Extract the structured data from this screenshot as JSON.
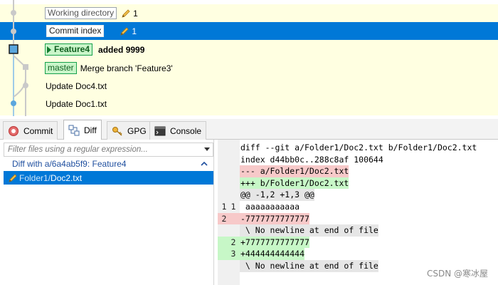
{
  "graph": {
    "rows": [
      {
        "label": "Working directory",
        "count": "1"
      },
      {
        "label": "Commit index",
        "count": "1"
      },
      {
        "branch": "Feature4",
        "message": "added 9999"
      },
      {
        "branch": "master",
        "message": "Merge branch 'Feature3'"
      },
      {
        "message": "Update Doc4.txt"
      },
      {
        "message": "Update Doc1.txt"
      }
    ]
  },
  "tabs": [
    {
      "label": "Commit",
      "icon": "commit-icon"
    },
    {
      "label": "Diff",
      "icon": "diff-icon"
    },
    {
      "label": "GPG",
      "icon": "key-icon"
    },
    {
      "label": "Console",
      "icon": "console-icon"
    }
  ],
  "filelist": {
    "filter_placeholder": "Filter files using a regular expression...",
    "group_header": "Diff with a/6a4ab5f9: Feature4",
    "file": {
      "dir": "Folder1/",
      "name": "Doc2.txt"
    }
  },
  "diff": {
    "lines": [
      {
        "left": "",
        "right": "",
        "text": "diff --git a/Folder1/Doc2.txt b/Folder1/Doc2.txt",
        "kind": "header"
      },
      {
        "left": "",
        "right": "",
        "text": "index d44bb0c..288c8af 100644",
        "kind": "header"
      },
      {
        "left": "",
        "right": "",
        "text": "--- a/Folder1/Doc2.txt",
        "kind": "removed-header"
      },
      {
        "left": "",
        "right": "",
        "text": "+++ b/Folder1/Doc2.txt",
        "kind": "added-header"
      },
      {
        "left": "",
        "right": "",
        "text": "@@ -1,2 +1,3 @@",
        "kind": "hunk"
      },
      {
        "left": "1",
        "right": "1",
        "text": " aaaaaaaaaaa",
        "kind": "context"
      },
      {
        "left": "2",
        "right": "",
        "text": "-7777777777777",
        "kind": "removed"
      },
      {
        "left": "",
        "right": "",
        "text": " \\ No newline at end of file",
        "kind": "note"
      },
      {
        "left": "",
        "right": "2",
        "text": "+7777777777777",
        "kind": "added"
      },
      {
        "left": "",
        "right": "3",
        "text": "+444444444444",
        "kind": "added"
      },
      {
        "left": "",
        "right": "",
        "text": " \\ No newline at end of file",
        "kind": "note"
      }
    ]
  },
  "watermark": "CSDN @寒冰屋",
  "colors": {
    "selection": "#0078d7",
    "graph_background": "#ffffe1",
    "branch_label": "#c9f5c9",
    "graph_line": "#9ecbe8",
    "graph_line_strong": "#5aa6dd",
    "removed": "#f7c9c9",
    "added": "#c7f7c7"
  }
}
